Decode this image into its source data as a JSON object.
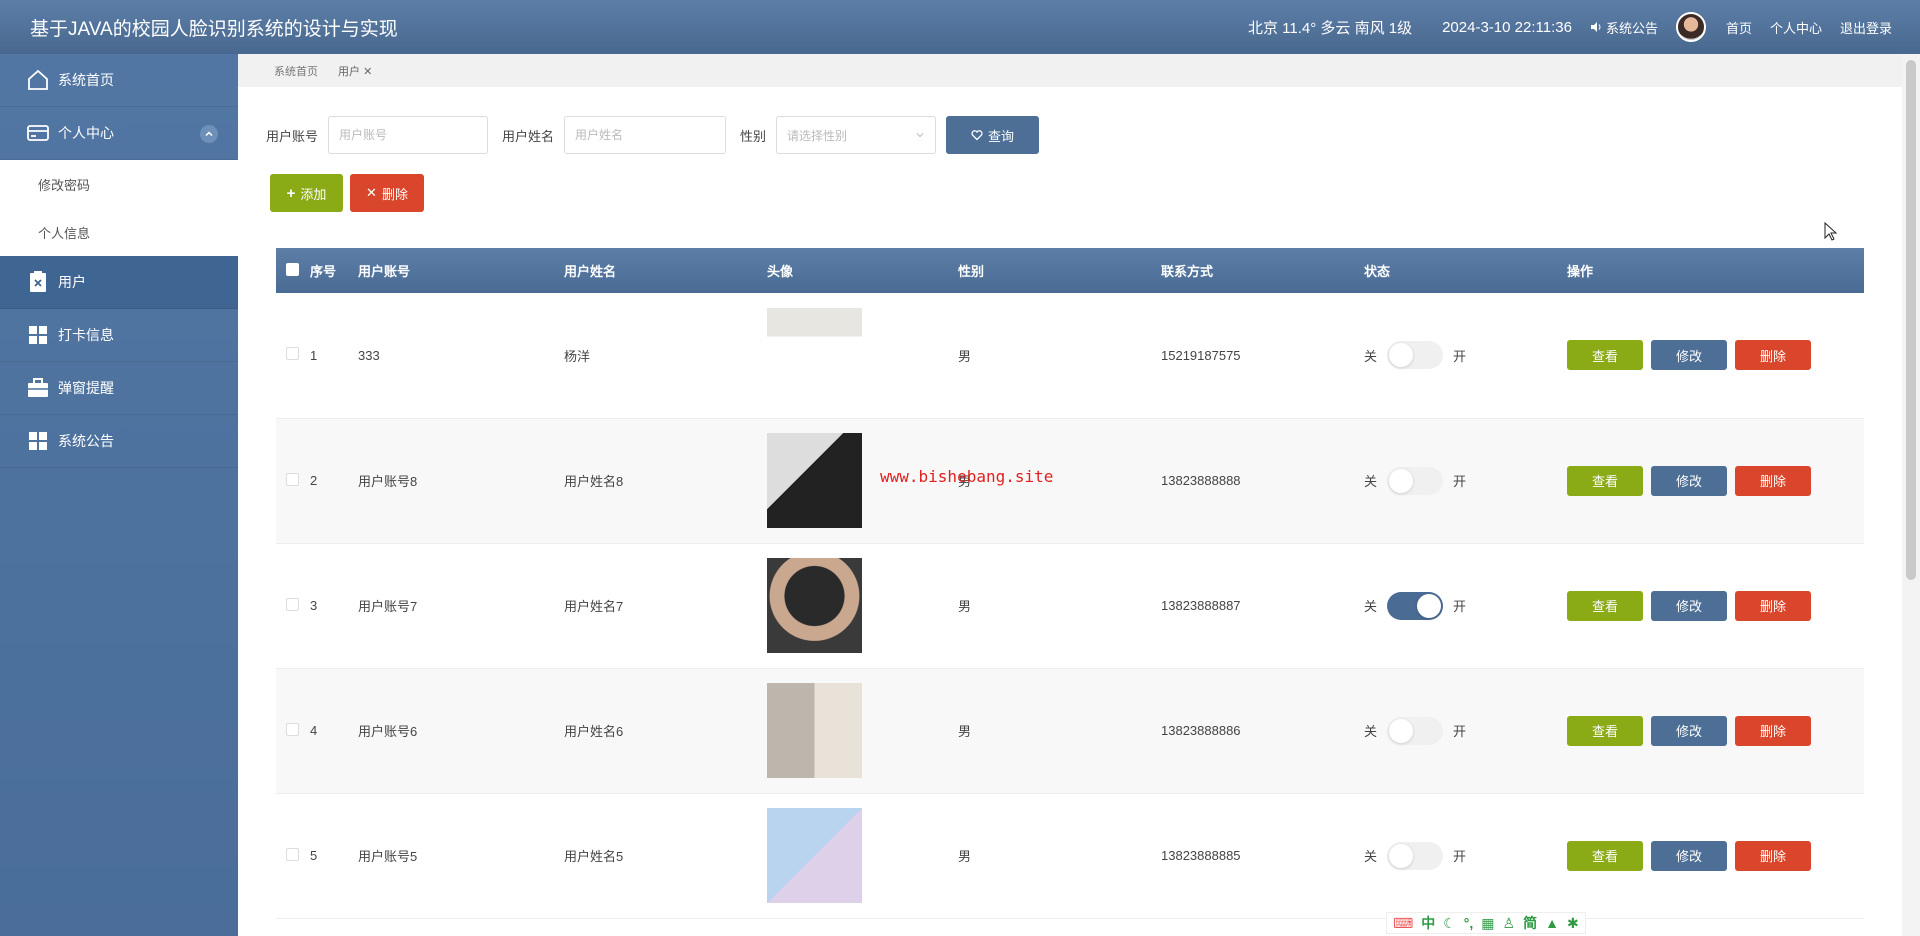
{
  "header": {
    "title": "基于JAVA的校园人脸识别系统的设计与实现",
    "weather": "北京 11.4° 多云 南风 1级",
    "datetime": "2024-3-10 22:11:36",
    "notice": "系统公告",
    "links": [
      "首页",
      "个人中心",
      "退出登录"
    ]
  },
  "sidebar": {
    "items": [
      {
        "label": "系统首页",
        "icon": "home-icon"
      },
      {
        "label": "个人中心",
        "icon": "card-icon"
      },
      {
        "label": "用户",
        "icon": "clipboard-icon"
      },
      {
        "label": "打卡信息",
        "icon": "grid-icon"
      },
      {
        "label": "弹窗提醒",
        "icon": "briefcase-icon"
      },
      {
        "label": "系统公告",
        "icon": "grid-icon"
      }
    ],
    "sub_items": [
      "修改密码",
      "个人信息"
    ]
  },
  "breadcrumb": {
    "home": "系统首页",
    "current": "用户"
  },
  "filter": {
    "account_label": "用户账号",
    "account_placeholder": "用户账号",
    "name_label": "用户姓名",
    "name_placeholder": "用户姓名",
    "gender_label": "性别",
    "gender_placeholder": "请选择性别",
    "query_button": "查询"
  },
  "actions": {
    "add": "添加",
    "delete": "删除"
  },
  "table": {
    "columns": [
      "序号",
      "用户账号",
      "用户姓名",
      "头像",
      "性别",
      "联系方式",
      "状态",
      "操作"
    ],
    "rows": [
      {
        "no": "1",
        "account": "333",
        "name": "杨洋",
        "gender": "男",
        "phone": "15219187575",
        "status_on": false
      },
      {
        "no": "2",
        "account": "用户账号8",
        "name": "用户姓名8",
        "gender": "男",
        "phone": "13823888888",
        "status_on": false
      },
      {
        "no": "3",
        "account": "用户账号7",
        "name": "用户姓名7",
        "gender": "男",
        "phone": "13823888887",
        "status_on": true
      },
      {
        "no": "4",
        "account": "用户账号6",
        "name": "用户姓名6",
        "gender": "男",
        "phone": "13823888886",
        "status_on": false
      },
      {
        "no": "5",
        "account": "用户账号5",
        "name": "用户姓名5",
        "gender": "男",
        "phone": "13823888885",
        "status_on": false
      }
    ],
    "status_off_label": "关",
    "status_on_label": "开",
    "btn_view": "查看",
    "btn_edit": "修改",
    "btn_delete": "删除"
  },
  "watermark": "www.bishebang.site",
  "ime": [
    "中",
    "简"
  ]
}
